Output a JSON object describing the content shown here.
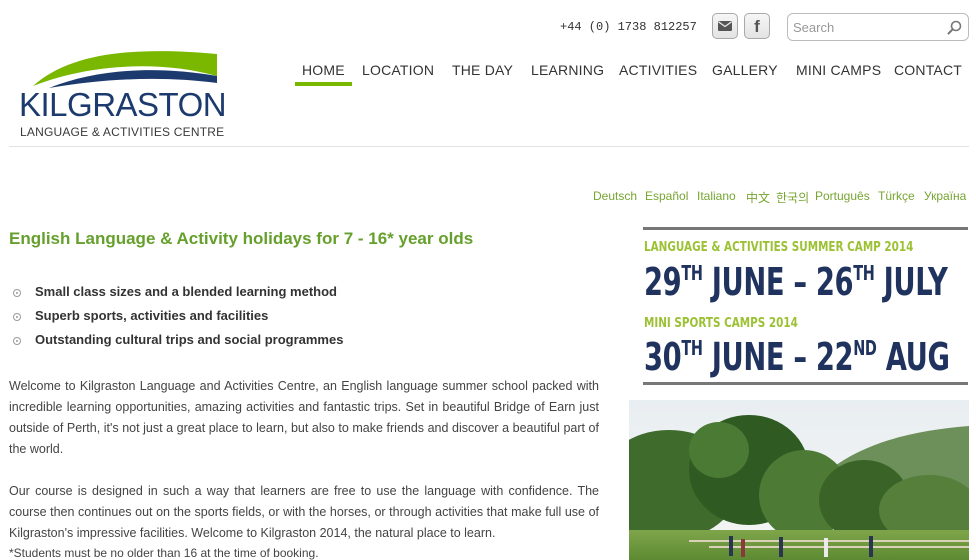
{
  "header": {
    "phone": "+44 (0) 1738 812257",
    "search": {
      "placeholder": "Search"
    },
    "social": [
      {
        "name": "email-icon"
      },
      {
        "name": "facebook-icon",
        "glyph": "f"
      }
    ]
  },
  "logo": {
    "name": "KILGRASTON",
    "subtitle": "LANGUAGE & ACTIVITIES CENTRE",
    "colors": {
      "green": "#7ab800",
      "navy": "#1d3a6e"
    }
  },
  "nav": {
    "items": [
      {
        "label": "HOME",
        "active": true
      },
      {
        "label": "LOCATION"
      },
      {
        "label": "THE DAY"
      },
      {
        "label": "LEARNING"
      },
      {
        "label": "ACTIVITIES"
      },
      {
        "label": "GALLERY"
      },
      {
        "label": "MINI CAMPS"
      },
      {
        "label": "CONTACT"
      }
    ],
    "accent": "#7ab800"
  },
  "languages": [
    "Deutsch",
    "Español",
    "Italiano",
    "中文",
    "한국의",
    "Português",
    "Türkçe",
    "Україна"
  ],
  "main": {
    "headline": "English Language & Activity holidays for 7 - 16* year olds",
    "bullets": [
      "Small class sizes and a blended learning method",
      "Superb sports, activities and facilities",
      "Outstanding cultural trips and social programmes"
    ],
    "paragraphs": [
      "Welcome to Kilgraston Language and Activities Centre, an English language summer school packed with incredible learning opportunities, amazing activities and fantastic trips. Set in beautiful Bridge of Earn just outside of Perth, it's not just a great place to learn, but also to make friends and discover a beautiful part of the world.",
      "Our course is designed in such a way that learners are free to use the language with confidence. The course then continues out on the sports fields, or with the horses, or through activities that make full use of Kilgraston's impressive facilities. Welcome to Kilgraston 2014, the natural place to learn."
    ],
    "footnote": "*Students must be no older than 16 at the time of booking."
  },
  "banner": {
    "summer_title": "LANGUAGE & ACTIVITIES SUMMER CAMP 2014",
    "summer_d1": "29",
    "summer_s1": "TH",
    "summer_m1": " JUNE – 26",
    "summer_s2": "TH",
    "summer_m2": " JULY",
    "mini_title": "MINI SPORTS CAMPS 2014",
    "mini_d1": "30",
    "mini_s1": "TH",
    "mini_m1": " JUNE – 22",
    "mini_s2": "ND",
    "mini_m2": " AUG",
    "colors": {
      "green": "#9cc134",
      "navy": "#20335f"
    }
  },
  "photo": {
    "name": "campus-photo"
  }
}
